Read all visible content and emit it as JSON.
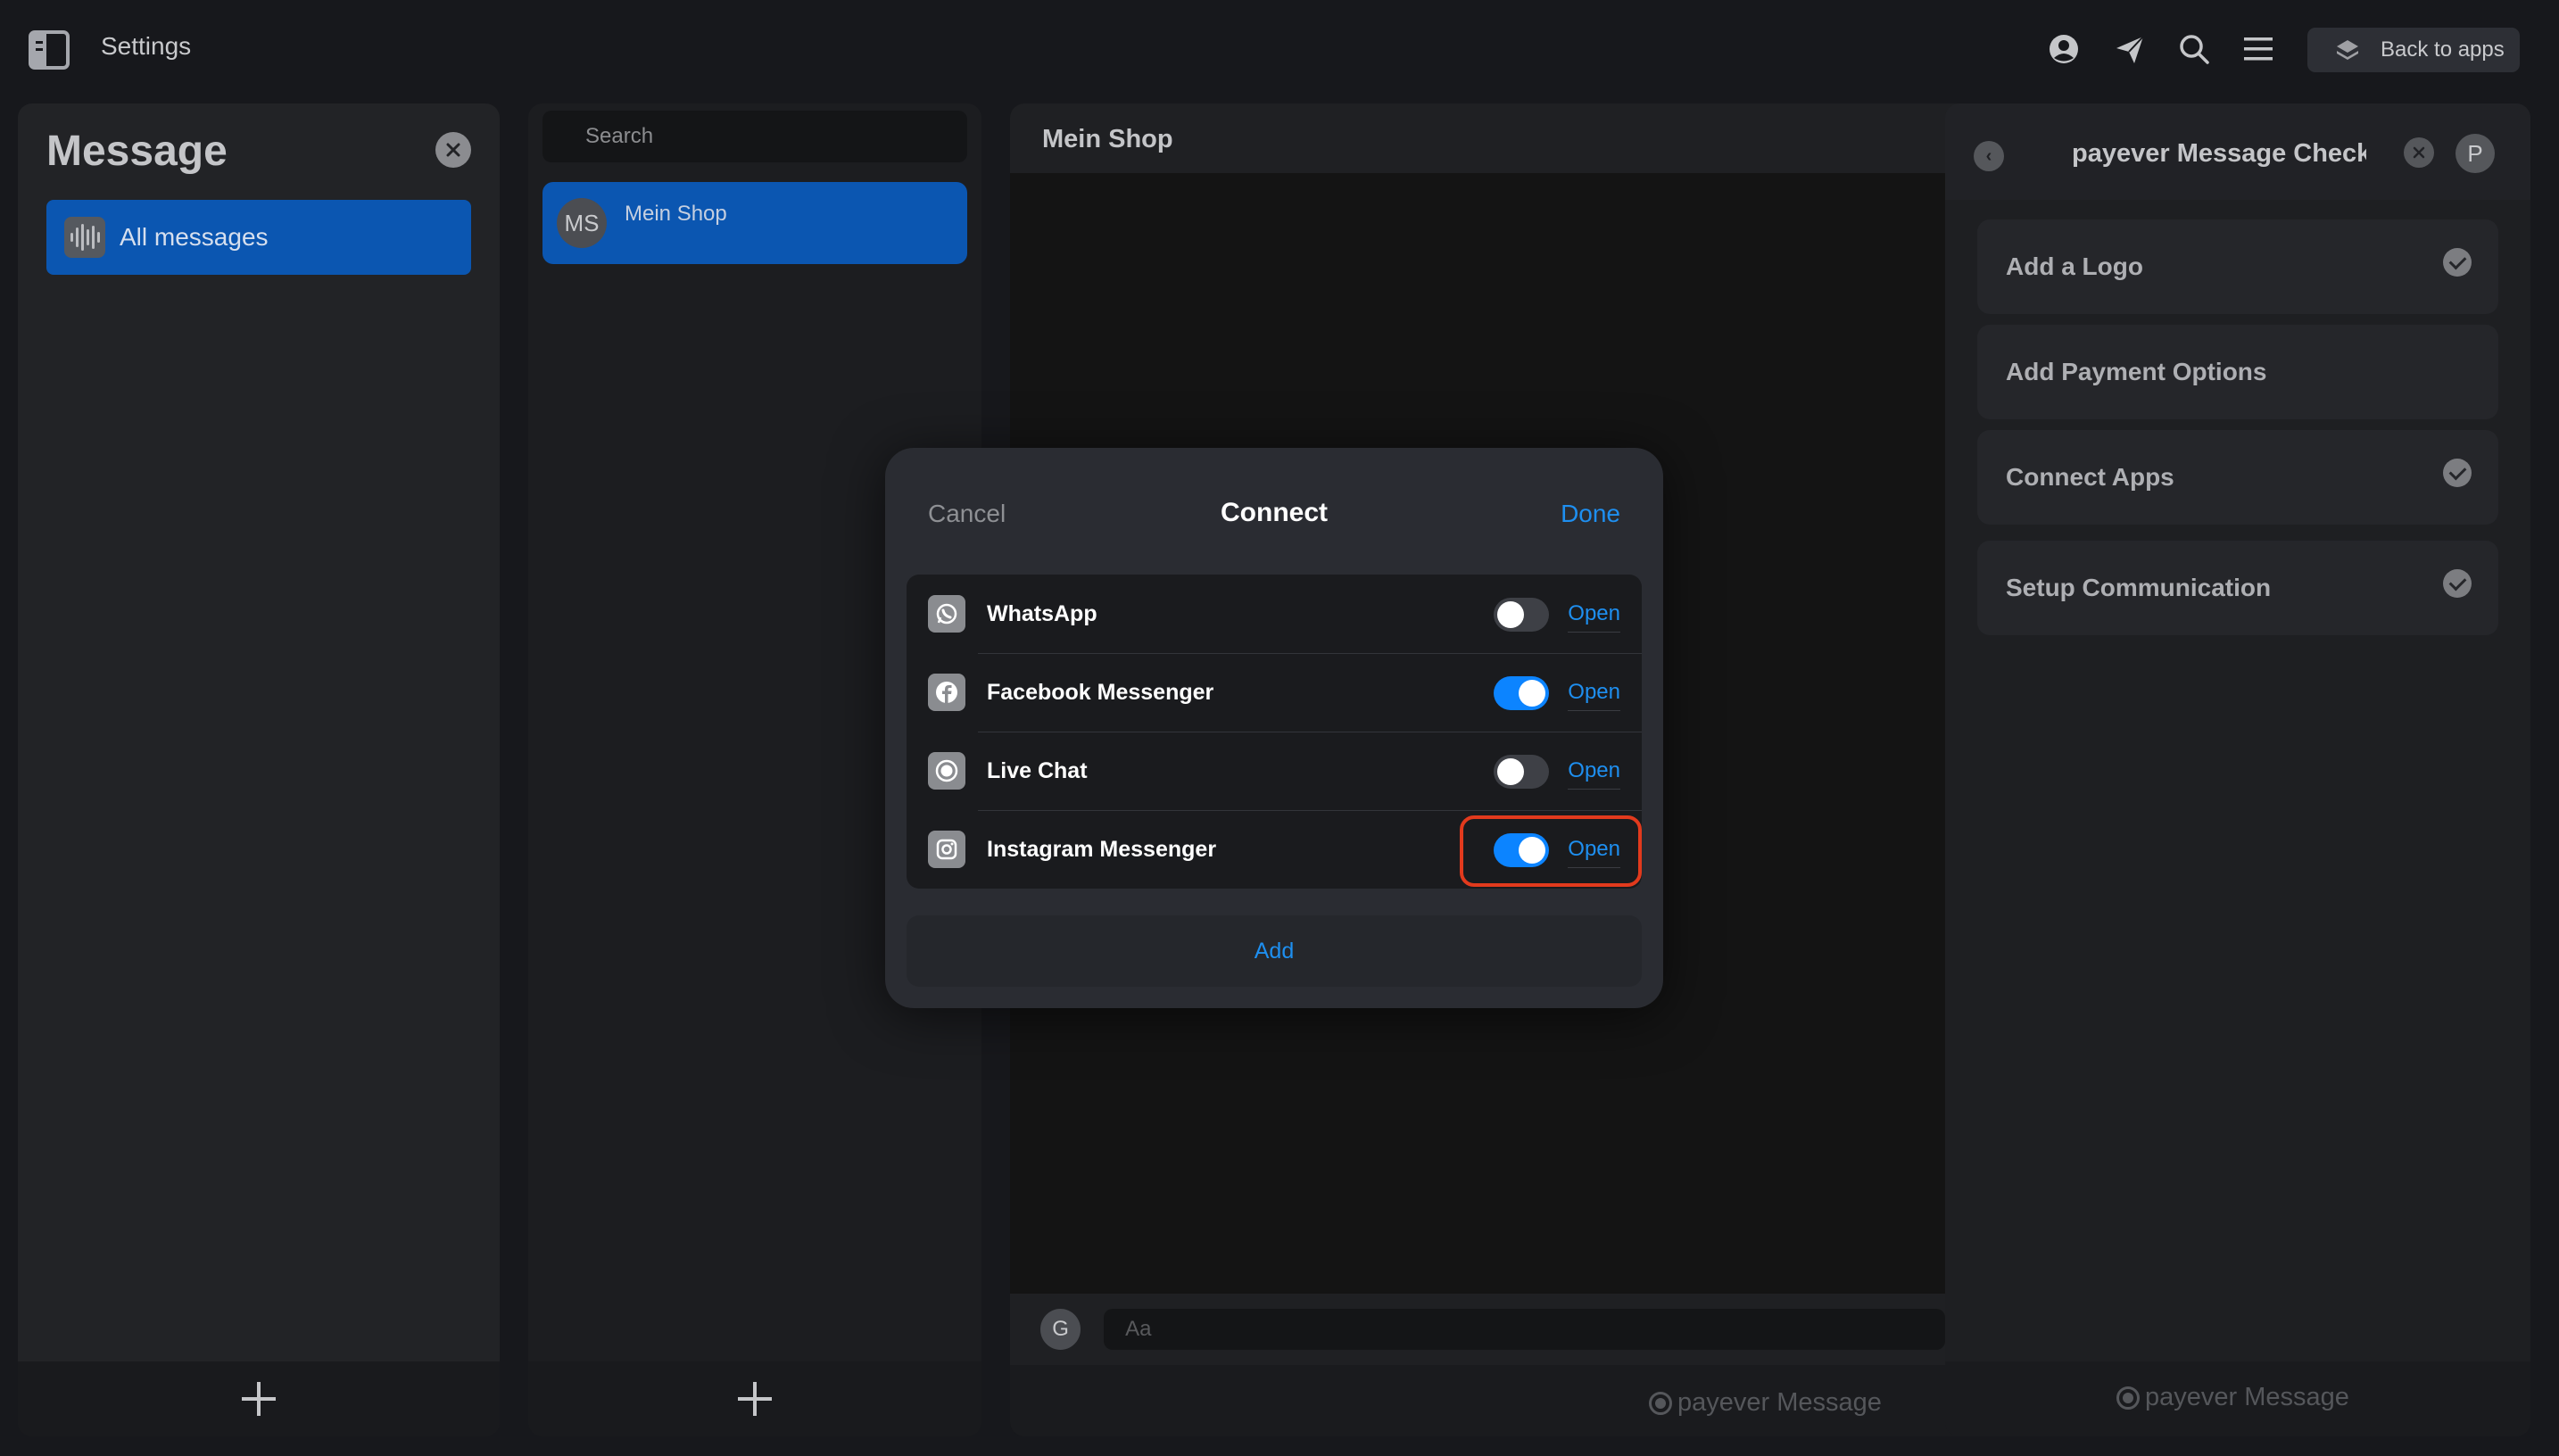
{
  "topbar": {
    "title": "Settings",
    "back_to_apps": "Back to apps",
    "icons": [
      "sidebar-toggle-icon",
      "user-circle-icon",
      "send-icon",
      "search-icon",
      "menu-icon",
      "layers-icon"
    ]
  },
  "folders": {
    "title": "Message",
    "items": [
      {
        "label": "All messages",
        "icon": "waveform-icon",
        "active": true
      }
    ]
  },
  "conversations": {
    "search_placeholder": "Search",
    "items": [
      {
        "initials": "MS",
        "name": "Mein Shop",
        "active": true
      }
    ]
  },
  "chat": {
    "title": "Mein Shop",
    "user_initial": "G",
    "input_placeholder": "Aa",
    "brand": "payever Message"
  },
  "checklist": {
    "title": "payever Message Checklis...",
    "avatar": "P",
    "items": [
      {
        "label": "Add a Logo",
        "checked": true
      },
      {
        "label": "Add Payment Options",
        "checked": false
      },
      {
        "label": "Connect Apps",
        "checked": true
      },
      {
        "label": "Setup Communication",
        "checked": true
      }
    ],
    "brand": "payever Message"
  },
  "modal": {
    "cancel": "Cancel",
    "title": "Connect",
    "done": "Done",
    "channels": [
      {
        "name": "WhatsApp",
        "icon": "whatsapp-icon",
        "enabled": false,
        "open_label": "Open"
      },
      {
        "name": "Facebook Messenger",
        "icon": "facebook-icon",
        "enabled": true,
        "open_label": "Open"
      },
      {
        "name": "Live Chat",
        "icon": "live-chat-icon",
        "enabled": false,
        "open_label": "Open"
      },
      {
        "name": "Instagram Messenger",
        "icon": "instagram-icon",
        "enabled": true,
        "open_label": "Open"
      }
    ],
    "add": "Add"
  },
  "colors": {
    "accent": "#0c84ff",
    "link": "#1e8ff0",
    "selected": "#0b56b1",
    "highlight": "#e23a1d"
  }
}
